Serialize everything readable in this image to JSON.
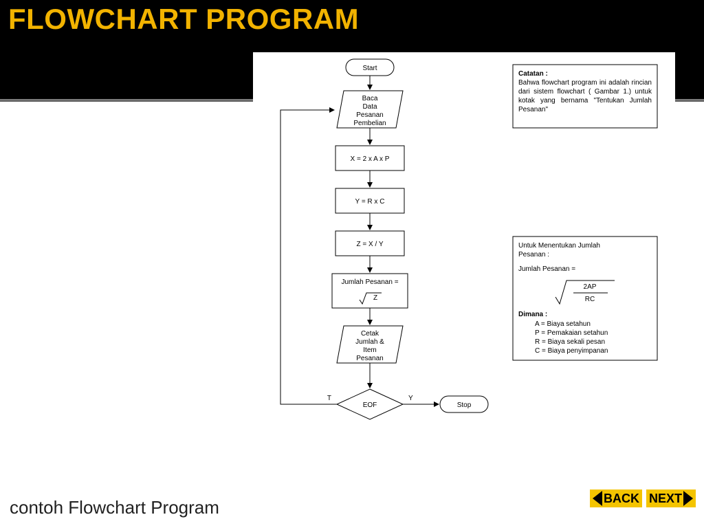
{
  "title": "FLOWCHART PROGRAM",
  "caption": "contoh Flowchart Program",
  "nav": {
    "back": "BACK",
    "next": "NEXT"
  },
  "flow": {
    "start": "Start",
    "stop": "Stop",
    "input_lines": [
      "Baca",
      "Data",
      "Pesanan",
      "Pembelian"
    ],
    "proc1": "X = 2 x A x P",
    "proc2": "Y = R x C",
    "proc3": "Z =  X / Y",
    "proc4_label": "Jumlah Pesanan =",
    "proc4_sqrt": "Z",
    "output_lines": [
      "Cetak",
      "Jumlah &",
      "Item",
      "Pesanan"
    ],
    "decision": "EOF",
    "decision_true": "T",
    "decision_yes": "Y"
  },
  "note1": {
    "heading": "Catatan :",
    "body": "Bahwa flowchart program ini adalah rincian dari sistem flowchart ( Gambar 1.) untuk kotak yang bernama \"Tentukan Jumlah Pesanan\""
  },
  "note2": {
    "lead_lines": [
      "Untuk Menentukan Jumlah",
      "Pesanan :"
    ],
    "formula_label": "Jumlah Pesanan =",
    "formula_num": "2AP",
    "formula_den": "RC",
    "dimana": "Dimana :",
    "defs": [
      "A = Biaya setahun",
      "P = Pemakaian setahun",
      "R = Biaya sekali pesan",
      "C = Biaya penyimpanan"
    ]
  }
}
